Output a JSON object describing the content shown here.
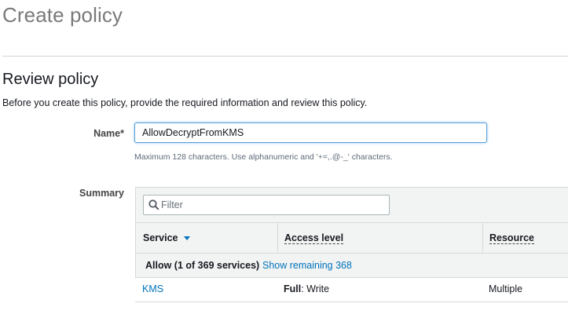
{
  "page": {
    "title": "Create policy"
  },
  "review": {
    "title": "Review policy",
    "description": "Before you create this policy, provide the required information and review this policy."
  },
  "name_field": {
    "label": "Name*",
    "value": "AllowDecryptFromKMS",
    "hint": "Maximum 128 characters. Use alphanumeric and '+=,.@-_' characters."
  },
  "summary": {
    "label": "Summary",
    "filter": {
      "placeholder": "Filter",
      "icon": "search-icon"
    },
    "columns": {
      "service": "Service",
      "access_level": "Access level",
      "resource": "Resource"
    },
    "group": {
      "label": "Allow (1 of 369 services)",
      "link": "Show remaining 368"
    },
    "rows": [
      {
        "service": "KMS",
        "access_bold": "Full",
        "access_rest": ": Write",
        "resource": "Multiple"
      }
    ]
  },
  "colors": {
    "link": "#0073bb",
    "title_gray": "#7a7a7a",
    "focus_border": "#5a9fd6"
  }
}
